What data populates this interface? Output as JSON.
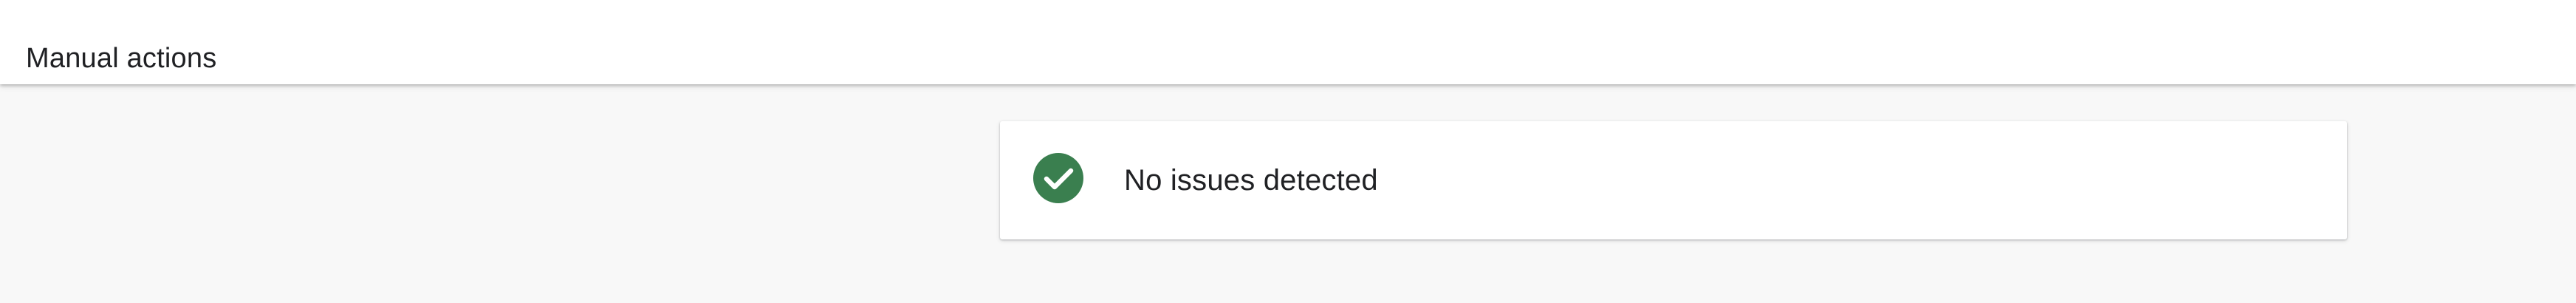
{
  "header": {
    "title": "Manual actions"
  },
  "status": {
    "message": "No issues detected",
    "icon": "check-circle-icon",
    "icon_color": "#3a7f4f"
  },
  "colors": {
    "page_background": "#f8f8f8",
    "header_background": "#ffffff",
    "card_background": "#ffffff",
    "text": "#202124"
  }
}
